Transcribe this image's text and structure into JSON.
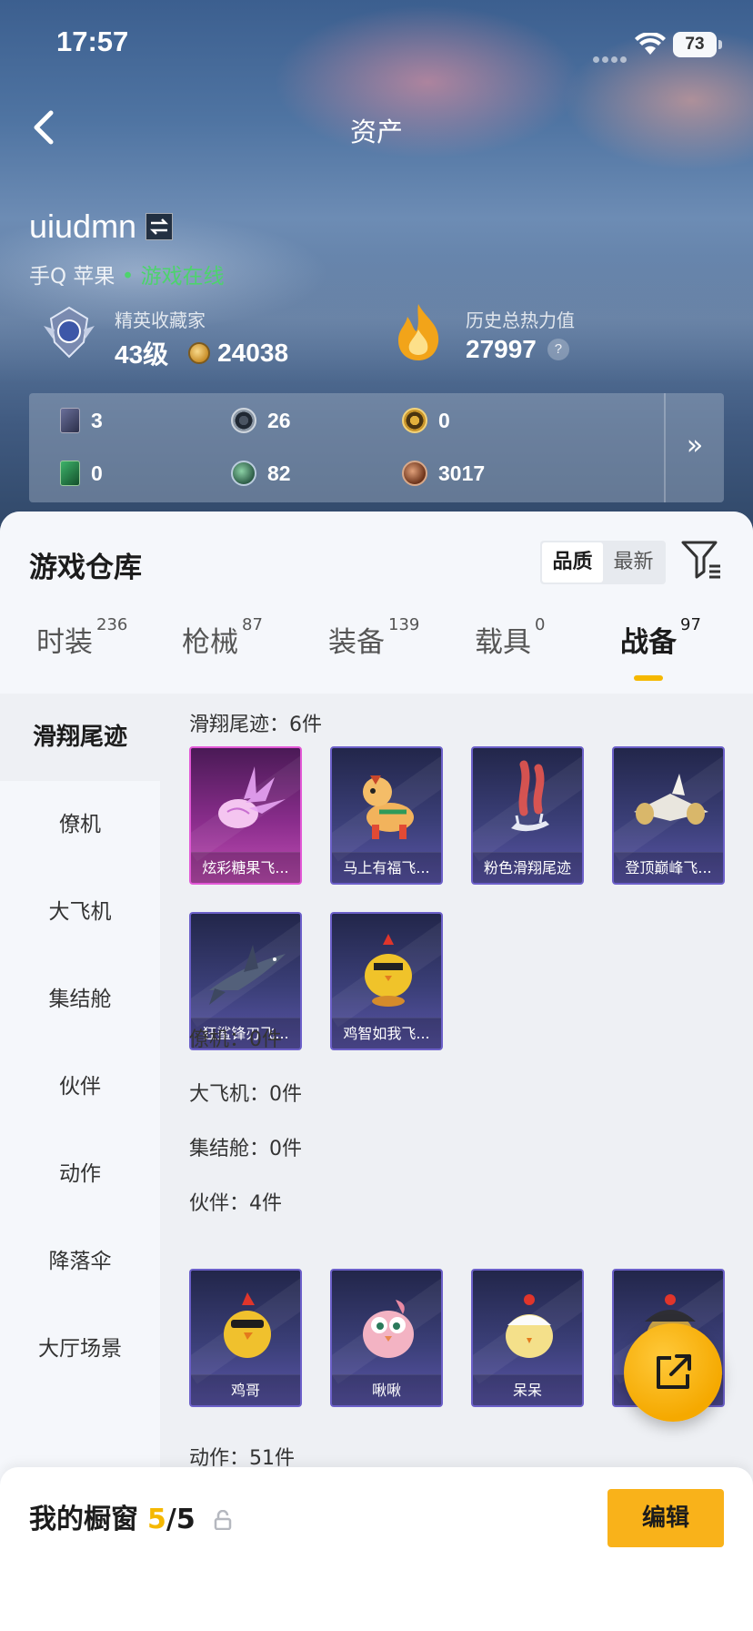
{
  "status_bar": {
    "time": "17:57",
    "battery": "73"
  },
  "nav": {
    "title": "资产"
  },
  "user": {
    "name": "uiudmn",
    "platform": "手Q 苹果",
    "status": "游戏在线"
  },
  "stats": {
    "collector": {
      "label": "精英收藏家",
      "level": "43级",
      "points": "24038"
    },
    "heat": {
      "label": "历史总热力值",
      "value": "27997",
      "help": "?"
    }
  },
  "currencies": [
    {
      "icon": "purple-card-icon",
      "value": "3"
    },
    {
      "icon": "silver-gear-coin-icon",
      "value": "26"
    },
    {
      "icon": "gold-emblem-coin-icon",
      "value": "0"
    },
    {
      "icon": "green-card-icon",
      "value": "0"
    },
    {
      "icon": "green-orb-coin-icon",
      "value": "82"
    },
    {
      "icon": "bronze-coin-icon",
      "value": "3017"
    }
  ],
  "warehouse": {
    "title": "游戏仓库",
    "sort_options": [
      "品质",
      "最新"
    ],
    "sort_selected": "品质",
    "tabs": [
      {
        "label": "时装",
        "count": "236"
      },
      {
        "label": "枪械",
        "count": "87"
      },
      {
        "label": "装备",
        "count": "139"
      },
      {
        "label": "载具",
        "count": "0"
      },
      {
        "label": "战备",
        "count": "97"
      }
    ],
    "active_tab": "战备",
    "categories": [
      "滑翔尾迹",
      "僚机",
      "大飞机",
      "集结舱",
      "伙伴",
      "动作",
      "降落伞",
      "大厅场景"
    ],
    "active_category": "滑翔尾迹",
    "sections": [
      {
        "title": "滑翔尾迹：6件",
        "items": [
          "炫彩糖果飞...",
          "马上有福飞...",
          "粉色滑翔尾迹",
          "登顶巅峰飞...",
          "狂鲨锋刃飞...",
          "鸡智如我飞..."
        ]
      },
      {
        "title": "僚机：0件",
        "items": []
      },
      {
        "title": "大飞机：0件",
        "items": []
      },
      {
        "title": "集结舱：0件",
        "items": []
      },
      {
        "title": "伙伴：4件",
        "items": [
          "鸡哥",
          "啾啾",
          "呆呆",
          ""
        ]
      },
      {
        "title": "动作：51件",
        "items": []
      }
    ]
  },
  "showcase": {
    "label": "我的橱窗",
    "used": "5",
    "slash": "/",
    "total": "5",
    "edit_label": "编辑"
  },
  "colors": {
    "accent": "#f5b800",
    "online": "#4dd36d",
    "card_border": "#6c60c9",
    "pink_border": "#e258d6"
  }
}
